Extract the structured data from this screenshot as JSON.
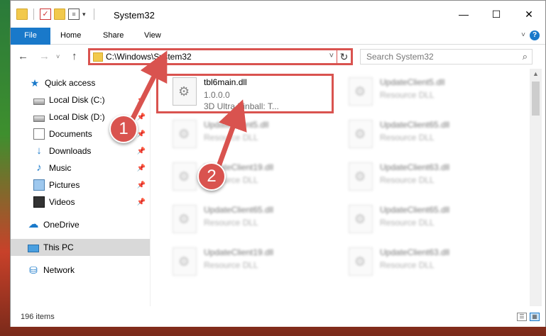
{
  "window": {
    "title": "System32",
    "controls": {
      "minimize": "—",
      "maximize": "☐",
      "close": "✕"
    }
  },
  "ribbon": {
    "tabs": [
      "File",
      "Home",
      "Share",
      "View"
    ],
    "help": "?",
    "expand": "˅"
  },
  "nav": {
    "back": "←",
    "forward": "→",
    "recent": "˅",
    "up": "↑",
    "address": "C:\\Windows\\System32",
    "address_dropdown": "˅",
    "refresh": "↻",
    "search_placeholder": "Search System32",
    "search_icon": "⌕"
  },
  "sidebar": {
    "items": [
      {
        "label": "Quick access",
        "icon": "star-icon",
        "pinned": false
      },
      {
        "label": "Local Disk (C:)",
        "icon": "disk-icon",
        "pinned": true
      },
      {
        "label": "Local Disk (D:)",
        "icon": "disk-icon",
        "pinned": true
      },
      {
        "label": "Documents",
        "icon": "document-icon",
        "pinned": true
      },
      {
        "label": "Downloads",
        "icon": "download-icon",
        "pinned": true
      },
      {
        "label": "Music",
        "icon": "music-icon",
        "pinned": true
      },
      {
        "label": "Pictures",
        "icon": "pictures-icon",
        "pinned": true
      },
      {
        "label": "Videos",
        "icon": "videos-icon",
        "pinned": true
      },
      {
        "label": "OneDrive",
        "icon": "cloud-icon",
        "pinned": false
      },
      {
        "label": "This PC",
        "icon": "pc-icon",
        "pinned": false,
        "selected": true
      },
      {
        "label": "Network",
        "icon": "network-icon",
        "pinned": false
      }
    ],
    "pin_glyph": "📌"
  },
  "files": [
    {
      "name": "tbl6main.dll",
      "line2": "1.0.0.0",
      "line3": "3D Ultra Pinball: T...",
      "blurred": false
    },
    {
      "name": "UpdateClient5.dll",
      "line2": "Resource DLL",
      "line3": "",
      "blurred": true
    },
    {
      "name": "UpdateClient5.dll",
      "line2": "Resource DLL",
      "line3": "",
      "blurred": true
    },
    {
      "name": "UpdateClient65.dll",
      "line2": "Resource DLL",
      "line3": "",
      "blurred": true
    },
    {
      "name": "UpdateClient19.dll",
      "line2": "Resource DLL",
      "line3": "",
      "blurred": true
    },
    {
      "name": "UpdateClient63.dll",
      "line2": "Resource DLL",
      "line3": "",
      "blurred": true
    },
    {
      "name": "UpdateClient65.dll",
      "line2": "Resource DLL",
      "line3": "",
      "blurred": true
    },
    {
      "name": "UpdateClient65.dll",
      "line2": "Resource DLL",
      "line3": "",
      "blurred": true
    },
    {
      "name": "UpdateClient19.dll",
      "line2": "Resource DLL",
      "line3": "",
      "blurred": true
    },
    {
      "name": "UpdateClient63.dll",
      "line2": "Resource DLL",
      "line3": "",
      "blurred": true
    }
  ],
  "status": {
    "item_count": "196 items",
    "view_details": "☰",
    "view_tiles": "▦"
  },
  "callouts": [
    "1",
    "2"
  ],
  "colors": {
    "accent": "#1979ca",
    "annotation": "#d9534f"
  }
}
